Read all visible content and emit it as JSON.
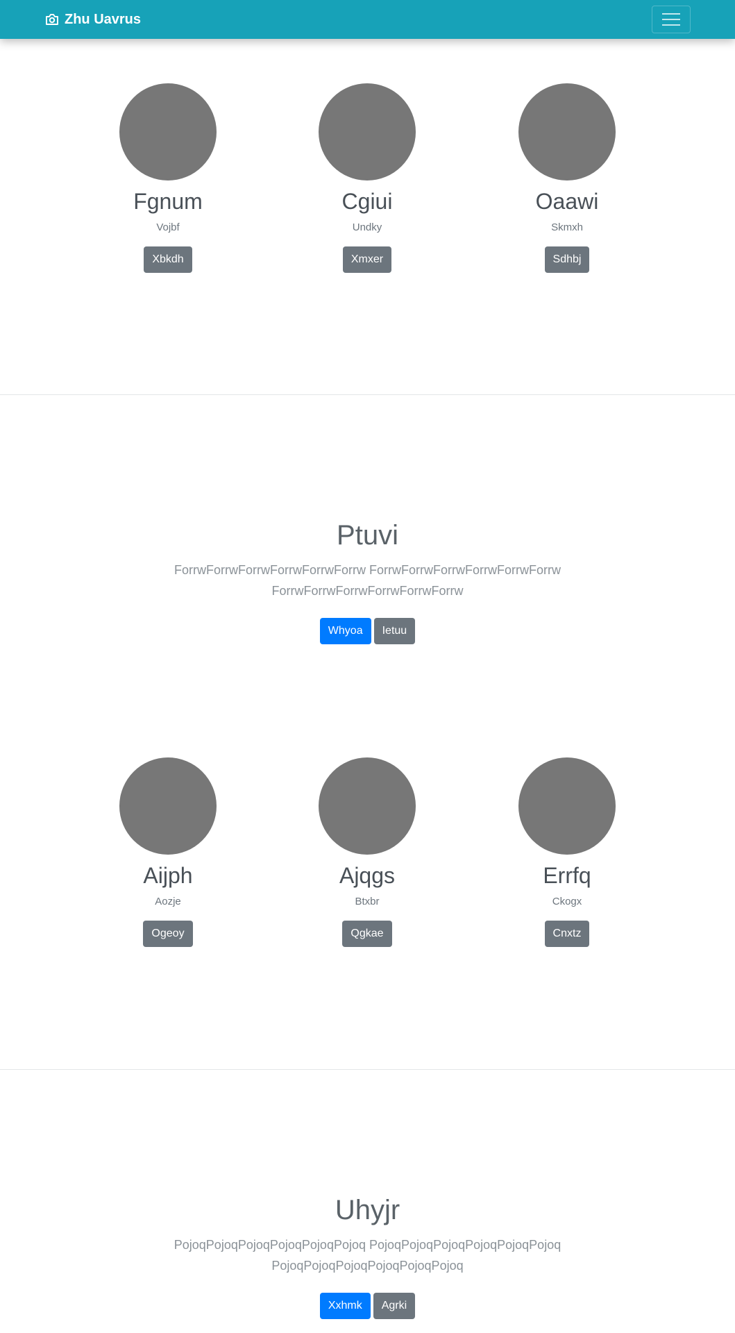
{
  "navbar": {
    "brand": "Zhu Uavrus",
    "brand_icon": "camera-icon",
    "toggle_icon": "hamburger-menu-icon",
    "color": "#17a2b8"
  },
  "album1": {
    "cards": [
      {
        "name": "Fgnum",
        "sub": "Vojbf",
        "button": "Xbkdh"
      },
      {
        "name": "Cgiui",
        "sub": "Undky",
        "button": "Xmxer"
      },
      {
        "name": "Oaawi",
        "sub": "Skmxh",
        "button": "Sdhbj"
      }
    ]
  },
  "hero1": {
    "title": "Ptuvi",
    "text": "ForrwForrwForrwForrwForrwForrw ForrwForrwForrwForrwForrwForrw ForrwForrwForrwForrwForrwForrw",
    "primary_button": "Whyoa",
    "secondary_button": "Ietuu"
  },
  "album2": {
    "cards": [
      {
        "name": "Aijph",
        "sub": "Aozje",
        "button": "Ogeoy"
      },
      {
        "name": "Ajqgs",
        "sub": "Btxbr",
        "button": "Qgkae"
      },
      {
        "name": "Errfq",
        "sub": "Ckogx",
        "button": "Cnxtz"
      }
    ]
  },
  "hero2": {
    "title": "Uhyjr",
    "text": "PojoqPojoqPojoqPojoqPojoqPojoq PojoqPojoqPojoqPojoqPojoqPojoq PojoqPojoqPojoqPojoqPojoqPojoq",
    "primary_button": "Xxhmk",
    "secondary_button": "Agrki"
  },
  "colors": {
    "primary": "#007bff",
    "secondary": "#6c757d",
    "avatar": "#777777"
  }
}
